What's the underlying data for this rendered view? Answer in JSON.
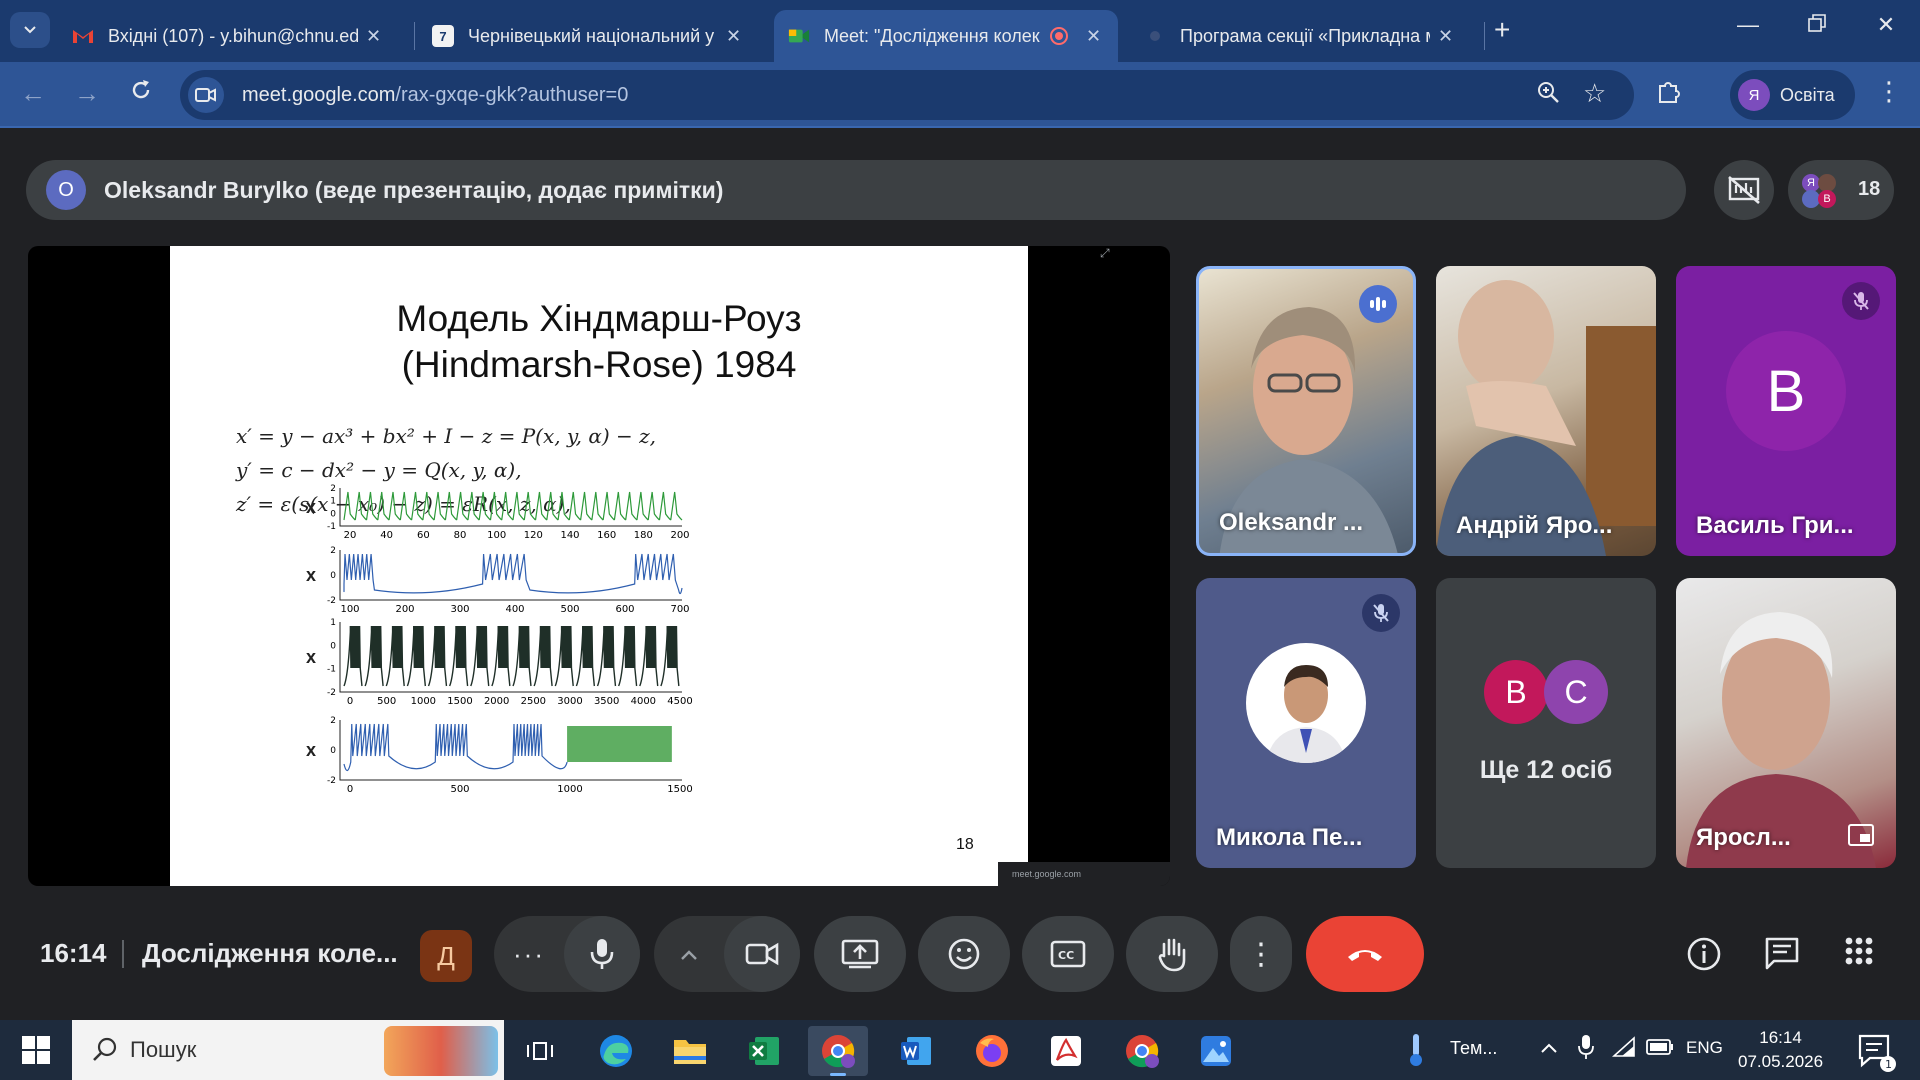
{
  "browser": {
    "tabs": [
      {
        "title": "Вхідні (107) - y.bihun@chnu.ed",
        "favicon": "gmail-icon",
        "active": false
      },
      {
        "title": "Чернівецький національний у",
        "favicon": "site-favicon",
        "favicon_text": "7",
        "active": false
      },
      {
        "title": "Meet: \"Дослідження колек",
        "favicon": "meet-icon",
        "active": true,
        "recording": true
      },
      {
        "title": "Програма секції «Прикладна м",
        "favicon": "dot-icon",
        "active": false
      }
    ],
    "url_host": "meet.google.com",
    "url_path": "/rax-gxqe-gkk?authuser=0",
    "profile_initial": "Я",
    "profile_name": "Освіта"
  },
  "meet": {
    "presenter_initial": "O",
    "presenter_text": "Oleksandr Burylko (веде презентацію, додає примітки)",
    "participant_count": "18",
    "people_chip_avatars": [
      "Я",
      "В"
    ],
    "slide": {
      "title_line1": "Модель Хіндмарш-Роуз",
      "title_line2": "(Hindmarsh-Rose) 1984",
      "eq1": "x′ = y − ax³ + bx² + I − z = P(x, y, α) − z,",
      "eq2": "y′ = c − dx² − y = Q(x, y, α),",
      "eq3": "z′ = ε(s(x − x₀) − z) = εR(x, z, α),",
      "page_number": "18",
      "plot_label": "x",
      "plots": [
        {
          "yticks": [
            "2",
            "1",
            "0",
            "-1"
          ],
          "xticks": [
            "20",
            "40",
            "60",
            "80",
            "100",
            "120",
            "140",
            "160",
            "180",
            "200"
          ],
          "color": "#2e9a3a"
        },
        {
          "yticks": [
            "2",
            "0",
            "-2"
          ],
          "xticks": [
            "100",
            "200",
            "300",
            "400",
            "500",
            "600",
            "700"
          ],
          "color": "#2f5fb0"
        },
        {
          "yticks": [
            "1",
            "0",
            "-1",
            "-2"
          ],
          "xticks": [
            "0",
            "500",
            "1000",
            "1500",
            "2000",
            "2500",
            "3000",
            "3500",
            "4000",
            "4500"
          ],
          "color": "#1f2f28"
        },
        {
          "yticks": [
            "2",
            "0",
            "-2"
          ],
          "xticks": [
            "0",
            "500",
            "1000",
            "1500"
          ],
          "color": "#2f5fb0"
        }
      ]
    },
    "watermark": "meet.google.com",
    "tiles": [
      {
        "name": "Oleksandr ...",
        "type": "video",
        "speaking": true,
        "badge": "speaking-icon"
      },
      {
        "name": "Андрій Яро...",
        "type": "video",
        "speaking": false
      },
      {
        "name": "Василь Гри...",
        "type": "avatar",
        "initial": "В",
        "avatar_color": "#8e24aa",
        "badge": "mic-off-icon"
      },
      {
        "name": "Микола Пе...",
        "type": "photo",
        "badge": "mic-off-icon"
      },
      {
        "name": "Ще 12 осіб",
        "type": "more",
        "initials": [
          "В",
          "С"
        ]
      },
      {
        "name": "Яросл...",
        "type": "video",
        "badge": "pip-icon"
      }
    ],
    "time": "16:14",
    "meeting_title": "Дослідження коле...",
    "lang_badge": "Д"
  },
  "taskbar": {
    "search_placeholder": "Пошук",
    "weather": "Тем...",
    "lang": "ENG",
    "time": "16:14",
    "date": "07.05.2026",
    "notifications": "1"
  },
  "colors": {
    "tabbar": "#1b3a6e",
    "toolbar": "#2e5596",
    "meet_bg": "#202124",
    "end_call": "#ea4335",
    "speaking_border": "#8ab4f8"
  }
}
